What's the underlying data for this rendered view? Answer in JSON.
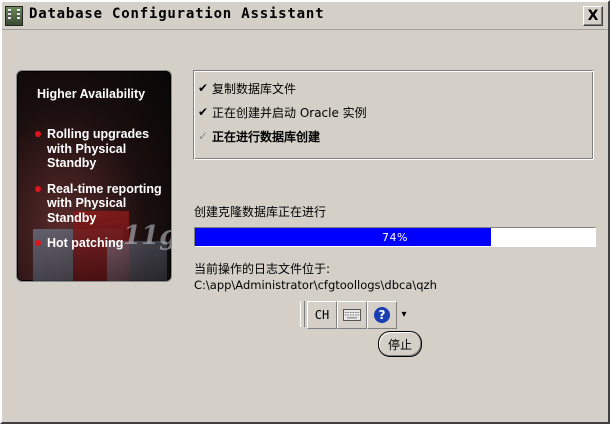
{
  "window": {
    "title": "Database Configuration Assistant",
    "close_label": "X"
  },
  "promo": {
    "heading": "Higher Availability",
    "items": [
      {
        "label": "Rolling upgrades with Physical Standby"
      },
      {
        "label": "Real-time reporting with Physical Standby"
      },
      {
        "label": "Hot patching"
      }
    ],
    "logo_text": "11g"
  },
  "steps": [
    {
      "check": "✔",
      "label": "复制数据库文件",
      "state": "done"
    },
    {
      "check": "✔",
      "label": "正在创建并启动 Oracle 实例",
      "state": "done"
    },
    {
      "check": "✓",
      "label": "正在进行数据库创建",
      "state": "in-progress"
    }
  ],
  "progress": {
    "label": "创建克隆数据库正在进行",
    "percent_text": "74%",
    "fraction": 0.74,
    "fill_color": "#0000ff"
  },
  "log": {
    "label": "当前操作的日志文件位于:",
    "path": "C:\\app\\Administrator\\cfgtoollogs\\dbca\\qzh"
  },
  "ime": {
    "lang_label": "CH",
    "keyboard_icon": "keyboard-icon",
    "help_label": "?",
    "menu_arrow": "▾"
  },
  "buttons": {
    "stop_label": "停止"
  }
}
